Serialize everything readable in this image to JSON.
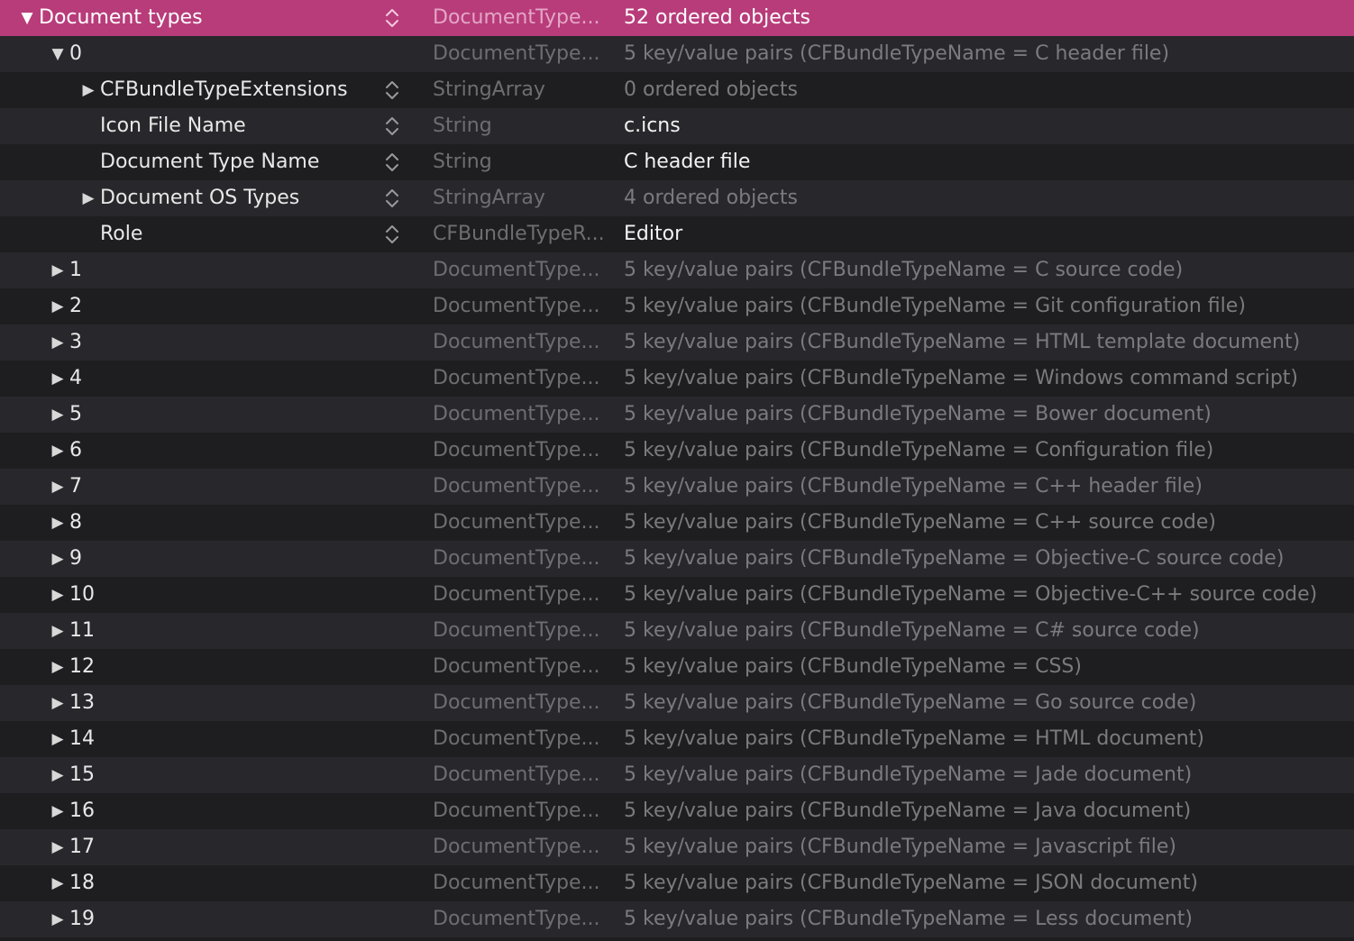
{
  "theme": {
    "selection": "#b83c7a",
    "row_even": "#28282c",
    "row_odd": "#1e1e21",
    "type_text": "#6e6e72",
    "dim_value": "#7b7b7f"
  },
  "rows": [
    {
      "key": "Document types",
      "level": 0,
      "disclosure": "expanded",
      "stepper": true,
      "type": "DocumentType...",
      "value": "52 ordered objects",
      "selected": true,
      "dim": false
    },
    {
      "key": "0",
      "level": 1,
      "disclosure": "expanded",
      "stepper": false,
      "type": "DocumentType...",
      "value": "5 key/value pairs (CFBundleTypeName = C header file)",
      "selected": false,
      "dim": true
    },
    {
      "key": "CFBundleTypeExtensions",
      "level": 2,
      "disclosure": "collapsed",
      "stepper": true,
      "type": "StringArray",
      "value": "0 ordered objects",
      "selected": false,
      "dim": true
    },
    {
      "key": "Icon File Name",
      "level": 2,
      "disclosure": "none",
      "stepper": true,
      "type": "String",
      "value": "c.icns",
      "selected": false,
      "dim": false
    },
    {
      "key": "Document Type Name",
      "level": 2,
      "disclosure": "none",
      "stepper": true,
      "type": "String",
      "value": "C header file",
      "selected": false,
      "dim": false
    },
    {
      "key": "Document OS Types",
      "level": 2,
      "disclosure": "collapsed",
      "stepper": true,
      "type": "StringArray",
      "value": "4 ordered objects",
      "selected": false,
      "dim": true
    },
    {
      "key": "Role",
      "level": 2,
      "disclosure": "none",
      "stepper": true,
      "type": "CFBundleTypeR...",
      "value": "Editor",
      "selected": false,
      "dim": false
    },
    {
      "key": "1",
      "level": 1,
      "disclosure": "collapsed",
      "stepper": false,
      "type": "DocumentType...",
      "value": "5 key/value pairs (CFBundleTypeName = C source code)",
      "selected": false,
      "dim": true
    },
    {
      "key": "2",
      "level": 1,
      "disclosure": "collapsed",
      "stepper": false,
      "type": "DocumentType...",
      "value": "5 key/value pairs (CFBundleTypeName = Git configuration file)",
      "selected": false,
      "dim": true
    },
    {
      "key": "3",
      "level": 1,
      "disclosure": "collapsed",
      "stepper": false,
      "type": "DocumentType...",
      "value": "5 key/value pairs (CFBundleTypeName = HTML template document)",
      "selected": false,
      "dim": true
    },
    {
      "key": "4",
      "level": 1,
      "disclosure": "collapsed",
      "stepper": false,
      "type": "DocumentType...",
      "value": "5 key/value pairs (CFBundleTypeName = Windows command script)",
      "selected": false,
      "dim": true
    },
    {
      "key": "5",
      "level": 1,
      "disclosure": "collapsed",
      "stepper": false,
      "type": "DocumentType...",
      "value": "5 key/value pairs (CFBundleTypeName = Bower document)",
      "selected": false,
      "dim": true
    },
    {
      "key": "6",
      "level": 1,
      "disclosure": "collapsed",
      "stepper": false,
      "type": "DocumentType...",
      "value": "5 key/value pairs (CFBundleTypeName = Configuration file)",
      "selected": false,
      "dim": true
    },
    {
      "key": "7",
      "level": 1,
      "disclosure": "collapsed",
      "stepper": false,
      "type": "DocumentType...",
      "value": "5 key/value pairs (CFBundleTypeName = C++ header file)",
      "selected": false,
      "dim": true
    },
    {
      "key": "8",
      "level": 1,
      "disclosure": "collapsed",
      "stepper": false,
      "type": "DocumentType...",
      "value": "5 key/value pairs (CFBundleTypeName = C++ source code)",
      "selected": false,
      "dim": true
    },
    {
      "key": "9",
      "level": 1,
      "disclosure": "collapsed",
      "stepper": false,
      "type": "DocumentType...",
      "value": "5 key/value pairs (CFBundleTypeName = Objective-C source code)",
      "selected": false,
      "dim": true
    },
    {
      "key": "10",
      "level": 1,
      "disclosure": "collapsed",
      "stepper": false,
      "type": "DocumentType...",
      "value": "5 key/value pairs (CFBundleTypeName = Objective-C++ source code)",
      "selected": false,
      "dim": true
    },
    {
      "key": "11",
      "level": 1,
      "disclosure": "collapsed",
      "stepper": false,
      "type": "DocumentType...",
      "value": "5 key/value pairs (CFBundleTypeName = C# source code)",
      "selected": false,
      "dim": true
    },
    {
      "key": "12",
      "level": 1,
      "disclosure": "collapsed",
      "stepper": false,
      "type": "DocumentType...",
      "value": "5 key/value pairs (CFBundleTypeName = CSS)",
      "selected": false,
      "dim": true
    },
    {
      "key": "13",
      "level": 1,
      "disclosure": "collapsed",
      "stepper": false,
      "type": "DocumentType...",
      "value": "5 key/value pairs (CFBundleTypeName = Go source code)",
      "selected": false,
      "dim": true
    },
    {
      "key": "14",
      "level": 1,
      "disclosure": "collapsed",
      "stepper": false,
      "type": "DocumentType...",
      "value": "5 key/value pairs (CFBundleTypeName = HTML document)",
      "selected": false,
      "dim": true
    },
    {
      "key": "15",
      "level": 1,
      "disclosure": "collapsed",
      "stepper": false,
      "type": "DocumentType...",
      "value": "5 key/value pairs (CFBundleTypeName = Jade document)",
      "selected": false,
      "dim": true
    },
    {
      "key": "16",
      "level": 1,
      "disclosure": "collapsed",
      "stepper": false,
      "type": "DocumentType...",
      "value": "5 key/value pairs (CFBundleTypeName = Java document)",
      "selected": false,
      "dim": true
    },
    {
      "key": "17",
      "level": 1,
      "disclosure": "collapsed",
      "stepper": false,
      "type": "DocumentType...",
      "value": "5 key/value pairs (CFBundleTypeName = Javascript file)",
      "selected": false,
      "dim": true
    },
    {
      "key": "18",
      "level": 1,
      "disclosure": "collapsed",
      "stepper": false,
      "type": "DocumentType...",
      "value": "5 key/value pairs (CFBundleTypeName = JSON document)",
      "selected": false,
      "dim": true
    },
    {
      "key": "19",
      "level": 1,
      "disclosure": "collapsed",
      "stepper": false,
      "type": "DocumentType...",
      "value": "5 key/value pairs (CFBundleTypeName = Less document)",
      "selected": false,
      "dim": true
    }
  ]
}
